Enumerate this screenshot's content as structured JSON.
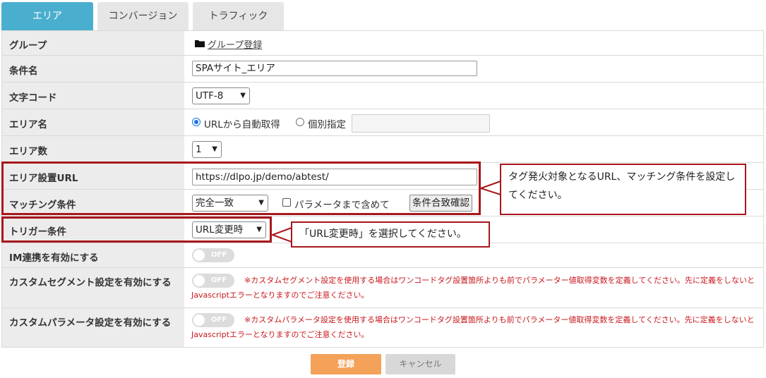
{
  "tabs": [
    {
      "label": "エリア",
      "active": true
    },
    {
      "label": "コンバージョン",
      "active": false
    },
    {
      "label": "トラフィック",
      "active": false
    }
  ],
  "rows": {
    "group": {
      "label": "グループ",
      "link": "グループ登録",
      "icon": "folder-icon"
    },
    "condition_name": {
      "label": "条件名",
      "value": "SPAサイト_エリア"
    },
    "charset": {
      "label": "文字コード",
      "selected": "UTF-8"
    },
    "area_name": {
      "label": "エリア名",
      "option_auto": "URLから自動取得",
      "option_manual": "個別指定",
      "selected": "auto",
      "manual_value": ""
    },
    "area_count": {
      "label": "エリア数",
      "selected": "1"
    },
    "area_url": {
      "label": "エリア設置URL",
      "value": "https://dlpo.jp/demo/abtest/"
    },
    "matching": {
      "label": "マッチング条件",
      "selected": "完全一致",
      "checkbox_label": "パラメータまで含めて",
      "checkbox_checked": false,
      "confirm_button": "条件合致確認"
    },
    "trigger": {
      "label": "トリガー条件",
      "selected": "URL変更時"
    },
    "im_link": {
      "label": "IM連携を有効にする",
      "toggle": "OFF"
    },
    "custom_segment": {
      "label": "カスタムセグメント設定を有効にする",
      "toggle": "OFF",
      "note_line1": "※カスタムセグメント設定を使用する場合はワンコードタグ設置箇所よりも前でパラメーター値取得変数を定義してください。先に定義をしないと",
      "note_line2": "Javascriptエラーとなりますのでご注意ください。"
    },
    "custom_param": {
      "label": "カスタムパラメータ設定を有効にする",
      "toggle": "OFF",
      "note_line1": "※カスタムパラメータ設定を使用する場合はワンコードタグ設置箇所よりも前でパラメーター値取得変数を定義してください。先に定義をしないと",
      "note_line2": "Javascriptエラーとなりますのでご注意ください。"
    }
  },
  "callouts": {
    "url_matching": "タグ発火対象となるURL、マッチング条件を設定してください。",
    "trigger": "「URL変更時」を選択してください。"
  },
  "buttons": {
    "submit": "登録",
    "cancel": "キャンセル"
  },
  "colors": {
    "tab_active": "#4aaecf",
    "highlight": "#a8171c",
    "submit": "#f4a15a",
    "note": "#c8181e"
  }
}
